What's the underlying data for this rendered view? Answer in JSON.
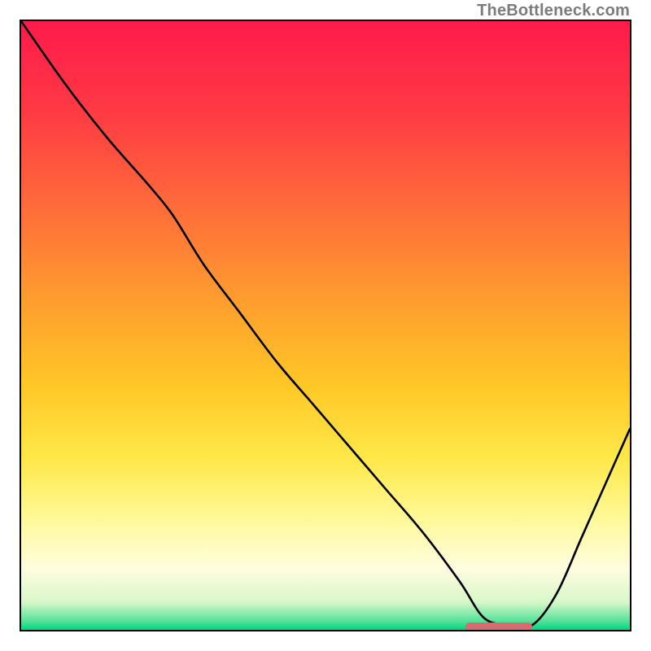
{
  "watermark": "TheBottleneck.com",
  "chart_data": {
    "type": "line",
    "title": "",
    "xlabel": "",
    "ylabel": "",
    "xlim": [
      0,
      100
    ],
    "ylim": [
      0,
      100
    ],
    "grid": false,
    "legend": false,
    "annotations": [
      {
        "name": "trough-marker",
        "x_start": 73,
        "x_end": 84,
        "y": 0.6,
        "color": "#d96a6f"
      }
    ],
    "background_gradient": {
      "stops": [
        {
          "offset": 0.0,
          "color": "#ff1a4b"
        },
        {
          "offset": 0.15,
          "color": "#ff3a44"
        },
        {
          "offset": 0.3,
          "color": "#ff6a3a"
        },
        {
          "offset": 0.45,
          "color": "#ff9a2f"
        },
        {
          "offset": 0.6,
          "color": "#ffc826"
        },
        {
          "offset": 0.72,
          "color": "#ffe84a"
        },
        {
          "offset": 0.82,
          "color": "#fff99a"
        },
        {
          "offset": 0.9,
          "color": "#fffde0"
        },
        {
          "offset": 0.955,
          "color": "#d6f7c8"
        },
        {
          "offset": 0.985,
          "color": "#58e29a"
        },
        {
          "offset": 1.0,
          "color": "#00d57c"
        }
      ]
    },
    "series": [
      {
        "name": "bottleneck-curve",
        "color": "#000000",
        "x": [
          0,
          7,
          14,
          21,
          25,
          30,
          36,
          42,
          48,
          54,
          60,
          66,
          72,
          76,
          80,
          84,
          88,
          92,
          96,
          100
        ],
        "y": [
          100,
          90,
          81,
          73,
          68,
          60,
          52,
          44,
          37,
          30,
          23,
          16,
          8,
          2,
          0.8,
          0.8,
          6,
          15,
          24,
          33
        ]
      }
    ]
  }
}
